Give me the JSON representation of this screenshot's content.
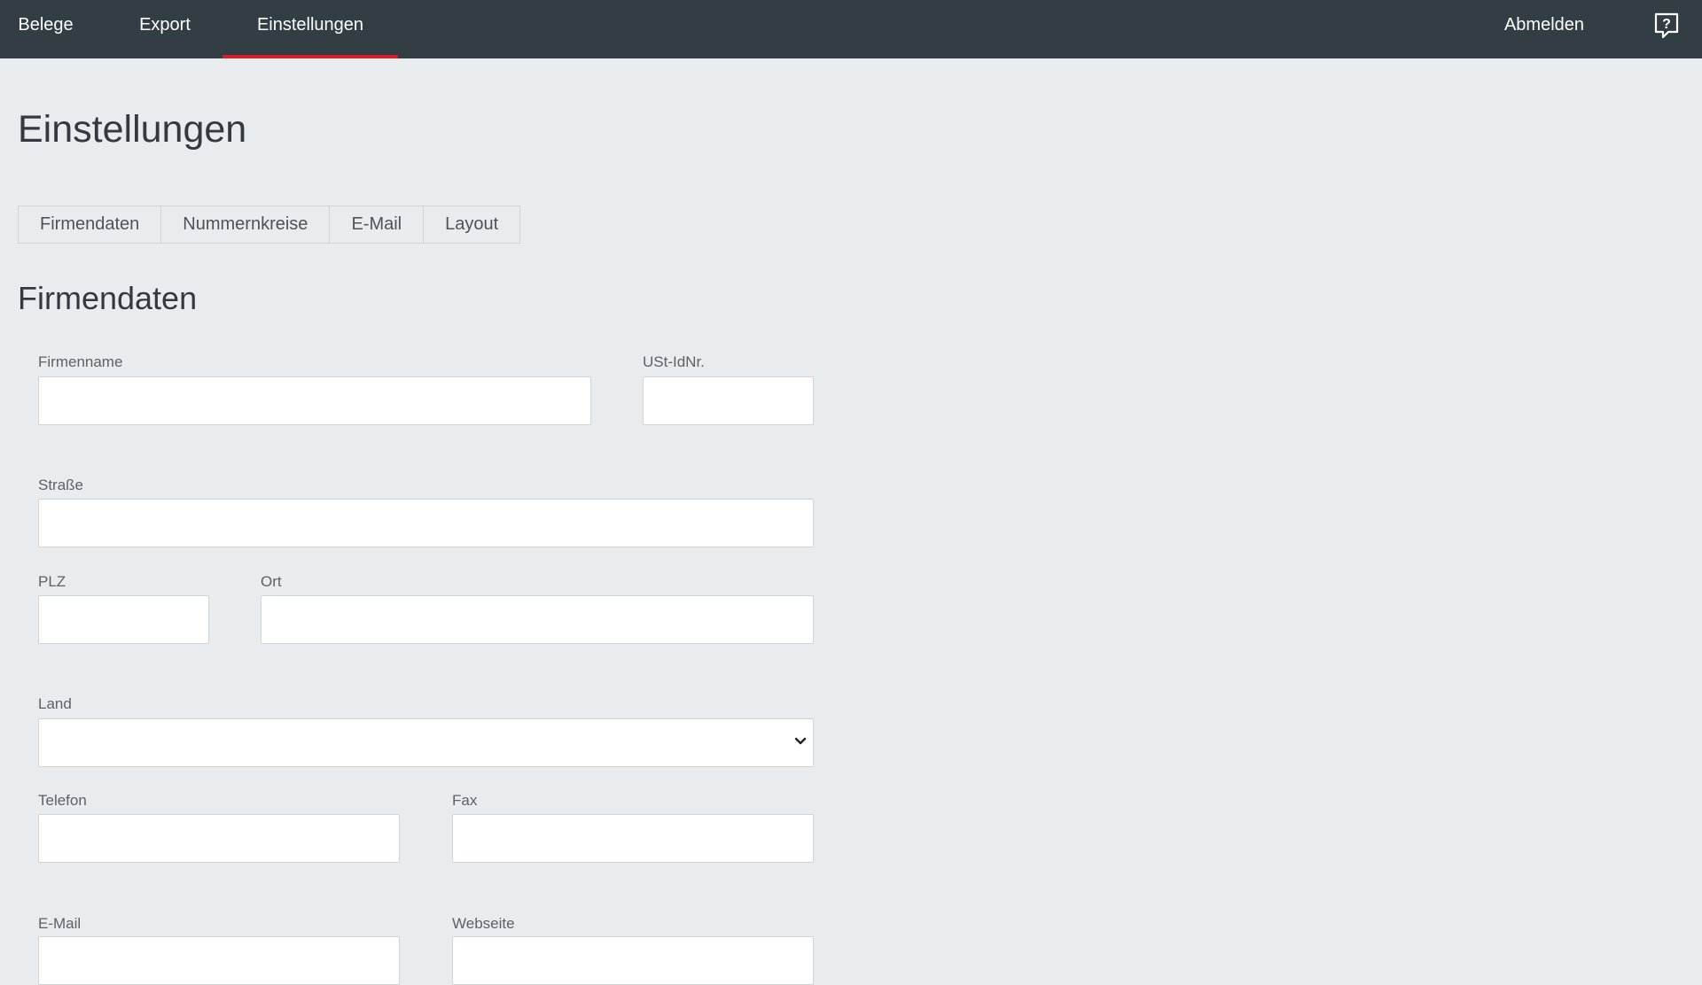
{
  "nav": {
    "items": [
      {
        "label": "Belege"
      },
      {
        "label": "Export"
      },
      {
        "label": "Einstellungen",
        "active": true
      }
    ],
    "logout_label": "Abmelden",
    "help_icon": "help-speech-bubble-icon"
  },
  "page": {
    "title": "Einstellungen"
  },
  "tabs": [
    {
      "label": "Firmendaten",
      "active": true
    },
    {
      "label": "Nummernkreise"
    },
    {
      "label": "E-Mail"
    },
    {
      "label": "Layout"
    }
  ],
  "section": {
    "title": "Firmendaten"
  },
  "form": {
    "firmenname": {
      "label": "Firmenname",
      "value": ""
    },
    "ustid": {
      "label": "USt-IdNr.",
      "value": ""
    },
    "strasse": {
      "label": "Straße",
      "value": ""
    },
    "plz": {
      "label": "PLZ",
      "value": ""
    },
    "ort": {
      "label": "Ort",
      "value": ""
    },
    "land": {
      "label": "Land",
      "value": ""
    },
    "telefon": {
      "label": "Telefon",
      "value": ""
    },
    "fax": {
      "label": "Fax",
      "value": ""
    },
    "email": {
      "label": "E-Mail",
      "value": ""
    },
    "webseite": {
      "label": "Webseite",
      "value": ""
    }
  },
  "colors": {
    "nav_bg": "#323e44",
    "accent": "#d3202a",
    "page_bg": "#e9ecee"
  }
}
